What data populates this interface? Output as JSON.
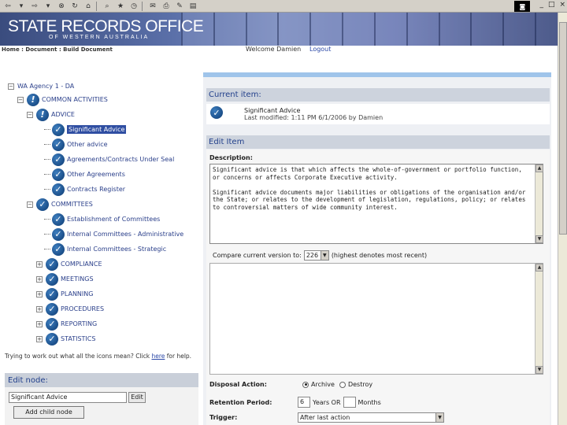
{
  "browser": {
    "toolbar_icons": [
      "back-icon",
      "forward-icon",
      "stop-icon",
      "refresh-icon",
      "home-icon",
      "search-icon",
      "favorites-icon",
      "history-icon",
      "mail-icon",
      "print-icon",
      "edit-icon"
    ],
    "window_controls": [
      "_",
      "□",
      "×"
    ]
  },
  "banner": {
    "title": "STATE RECORDS OFFICE",
    "subtitle": "OF WESTERN AUSTRALIA"
  },
  "crumbbar": {
    "breadcrumb": "Home : Document : Build Document",
    "welcome": "Welcome Damien",
    "logout": "Logout"
  },
  "tree": {
    "root": "WA Agency 1 - DA",
    "nodes": [
      {
        "label": "COMMON ACTIVITIES",
        "icon": "!"
      },
      {
        "label": "ADVICE",
        "icon": "!"
      },
      {
        "label": "Significant Advice",
        "icon": "✓",
        "selected": true
      },
      {
        "label": "Other advice",
        "icon": "✓"
      },
      {
        "label": "Agreements/Contracts Under Seal",
        "icon": "✓"
      },
      {
        "label": "Other Agreements",
        "icon": "✓"
      },
      {
        "label": "Contracts Register",
        "icon": "✓"
      },
      {
        "label": "COMMITTEES",
        "icon": "✓"
      },
      {
        "label": "Establishment of Committees",
        "icon": "✓"
      },
      {
        "label": "Internal Committees - Administrative",
        "icon": "✓"
      },
      {
        "label": "Internal Committees - Strategic",
        "icon": "✓"
      },
      {
        "label": "COMPLIANCE",
        "icon": "✓"
      },
      {
        "label": "MEETINGS",
        "icon": "✓"
      },
      {
        "label": "PLANNING",
        "icon": "✓"
      },
      {
        "label": "PROCEDURES",
        "icon": "✓"
      },
      {
        "label": "REPORTING",
        "icon": "✓"
      },
      {
        "label": "STATISTICS",
        "icon": "✓"
      }
    ],
    "help_prefix": "Trying to work out what all the icons mean? Click ",
    "help_link": "here",
    "help_suffix": " for help."
  },
  "edit_node": {
    "heading": "Edit node:",
    "value": "Significant Advice",
    "edit_button": "Edit",
    "add_child_button": "Add child node"
  },
  "current_item": {
    "heading": "Current item:",
    "title": "Significant Advice",
    "meta": "Last modified: 1:11 PM 6/1/2006 by Damien"
  },
  "edit_item": {
    "heading": "Edit Item",
    "description_label": "Description:",
    "description": "Significant advice is that which affects the whole-of-government or portfolio function, or concerns or affects Corporate Executive activity.\n\nSignificant advice documents major liabilities or obligations of the organisation and/or the State; or relates to the development of legislation, regulations, policy; or relates to controversial matters of wide community interest.",
    "compare_prefix": "Compare current version to:",
    "compare_value": "226",
    "compare_suffix": "(highest denotes most recent)",
    "disposal_label": "Disposal Action:",
    "disposal_options": [
      "Archive",
      "Destroy"
    ],
    "disposal_selected": "Archive",
    "retention_label": "Retention Period:",
    "retention_years": "6",
    "retention_years_unit": "Years OR",
    "retention_months": "",
    "retention_months_unit": "Months",
    "trigger_label": "Trigger:",
    "trigger_value": "After last action"
  }
}
